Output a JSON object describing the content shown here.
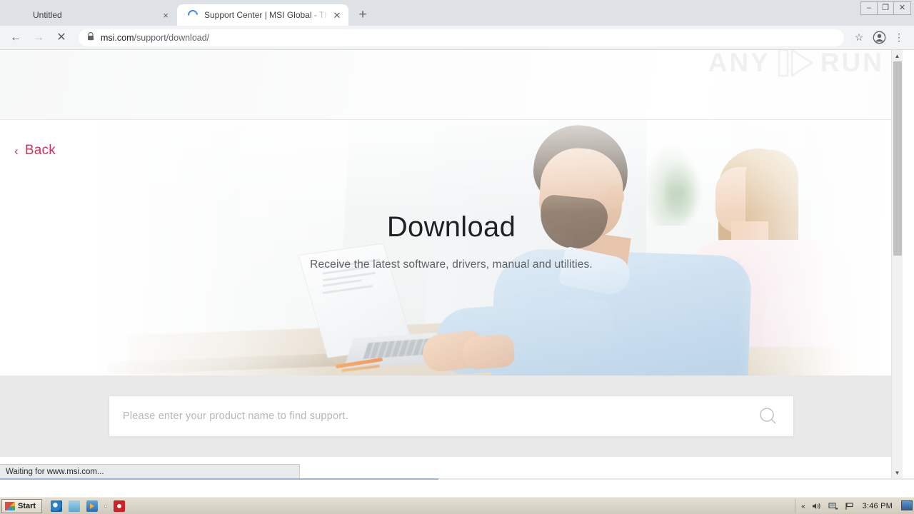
{
  "browser": {
    "tabs": [
      {
        "title": "Untitled",
        "active": false,
        "close_label": "×",
        "favicon": "blank-icon"
      },
      {
        "title": "Support Center | MSI Global - The Le",
        "active": true,
        "close_label": "✕",
        "favicon": "loading-spinner-icon"
      }
    ],
    "new_tab_label": "+",
    "window_controls": {
      "minimize": "–",
      "restore": "❐",
      "close": "✕"
    },
    "nav": {
      "back": "←",
      "forward": "→",
      "stop": "✕"
    },
    "omnibox": {
      "lock_icon": "lock-icon",
      "domain": "msi.com",
      "path": "/support/download/"
    },
    "actions": {
      "bookmark": "☆",
      "profile": "profile-avatar-icon",
      "menu": "⋮"
    }
  },
  "page": {
    "back_link": {
      "chevron": "‹",
      "label": "Back"
    },
    "hero": {
      "title": "Download",
      "subtitle": "Receive the latest software, drivers, manual and utilities."
    },
    "search": {
      "placeholder": "Please enter your product name to find support.",
      "value": "",
      "icon": "magnifier-icon"
    },
    "watermark": {
      "left": "ANY",
      "right": "RUN"
    }
  },
  "status": {
    "text": "Waiting for www.msi.com..."
  },
  "taskbar": {
    "start_label": "Start",
    "quick_launch": [
      {
        "name": "internet-explorer-icon"
      },
      {
        "name": "folder-icon"
      },
      {
        "name": "media-player-icon"
      },
      {
        "name": "chrome-icon"
      },
      {
        "name": "opera-icon"
      }
    ],
    "tray": {
      "chevron": "«",
      "icons": [
        "volume-icon",
        "network-icon",
        "flag-icon"
      ],
      "clock": "3:46 PM",
      "show_desktop": "show-desktop-icon"
    }
  },
  "colors": {
    "accent": "#d9305d",
    "chrome_tabstrip": "#dee1e6",
    "toolbar": "#f1f3f4",
    "search_band": "#e9e9e9",
    "watermark": "#f0f0f0"
  }
}
